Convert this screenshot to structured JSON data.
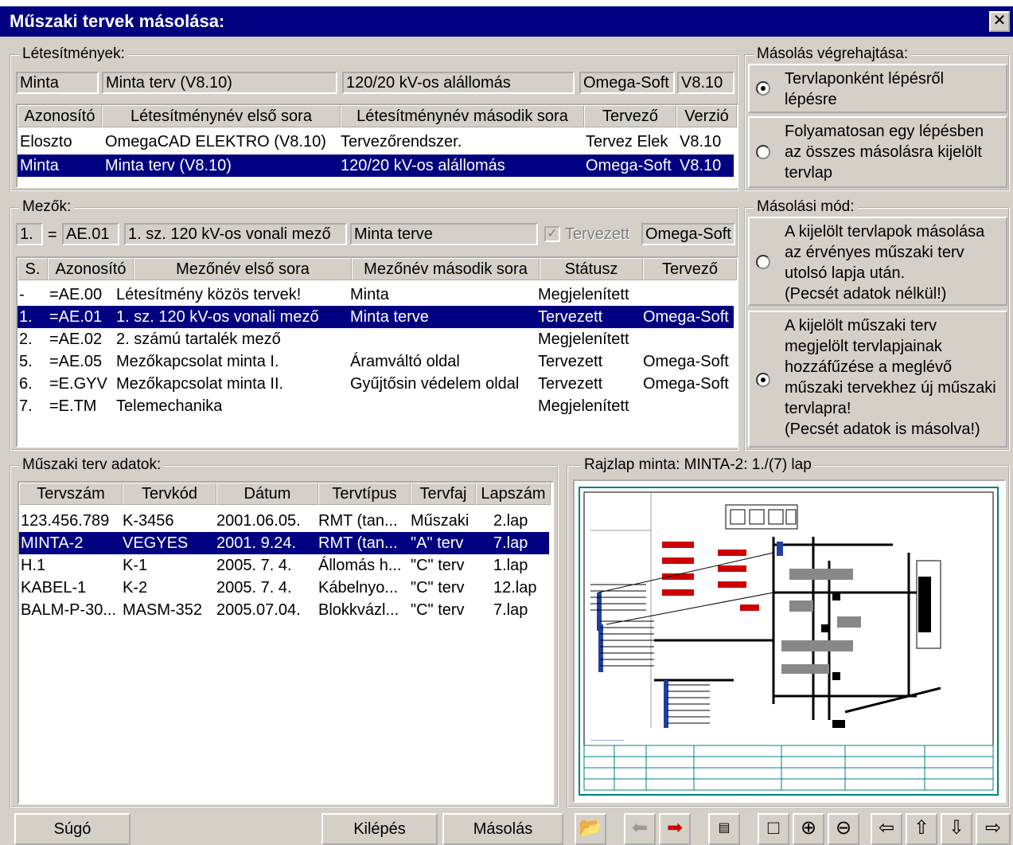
{
  "window": {
    "title": "Műszaki tervek másolása:",
    "close": "✕"
  },
  "letesitmenyek": {
    "legend": "Létesítmények:",
    "fields": [
      "Minta",
      "Minta terv (V8.10)",
      "120/20 kV-os alállomás",
      "Omega-Soft",
      "V8.10"
    ],
    "headers": [
      "Azonosító",
      "Létesítménynév első sora",
      "Létesítménynév második sora",
      "Tervező",
      "Verzió"
    ],
    "rows": [
      [
        "Eloszto",
        "OmegaCAD ELEKTRO (V8.10)",
        "Tervezőrendszer.",
        "Tervez Elek",
        "V8.10"
      ],
      [
        "Minta",
        "Minta terv (V8.10)",
        "120/20 kV-os alállomás",
        "Omega-Soft",
        "V8.10"
      ]
    ]
  },
  "masolas": {
    "legend": "Másolás végrehajtása:",
    "opt1": [
      "Tervlaponként lépésről",
      "lépésre"
    ],
    "opt2": [
      "Folyamatosan egy lépésben",
      "az összes másolásra kijelölt",
      "tervlap"
    ]
  },
  "mezok": {
    "legend": "Mezők:",
    "f_s": "1.",
    "f_eq": "=",
    "f_id": "AE.01",
    "f_name": "1. sz. 120 kV-os vonali mező",
    "f_name2": "Minta terve",
    "f_check": "Tervezett",
    "f_tervezo": "Omega-Soft",
    "headers": [
      "S.",
      "Azonosító",
      "Mezőnév első sora",
      "Mezőnév második sora",
      "Státusz",
      "Tervező"
    ],
    "rows": [
      [
        "-",
        "=AE.00",
        "Létesítmény közös tervek!",
        "Minta",
        "Megjelenített",
        ""
      ],
      [
        "1.",
        "=AE.01",
        "1. sz. 120 kV-os vonali mező",
        "Minta terve",
        "Tervezett",
        "Omega-Soft"
      ],
      [
        "2.",
        "=AE.02",
        "2. számú tartalék mező",
        "",
        "Megjelenített",
        ""
      ],
      [
        "5.",
        "=AE.05",
        "Mezőkapcsolat minta I.",
        "Áramváltó oldal",
        "Tervezett",
        "Omega-Soft"
      ],
      [
        "6.",
        "=E.GYV",
        "Mezőkapcsolat minta II.",
        "Gyűjtősin védelem oldal",
        "Tervezett",
        "Omega-Soft"
      ],
      [
        "7.",
        "=E.TM",
        "Telemechanika",
        "",
        "Megjelenített",
        ""
      ]
    ]
  },
  "masolasi_mod": {
    "legend": "Másolási mód:",
    "opt1": [
      "A kijelölt tervlapok másolása",
      "az érvényes műszaki terv",
      "utolsó lapja után.",
      "(Pecsét adatok nélkül!)"
    ],
    "opt2": [
      "A kijelölt műszaki terv",
      "megjelölt tervlapjainak",
      "hozzáfűzése a meglévő",
      "műszaki tervekhez új műszaki",
      "tervlapra!",
      "(Pecsét adatok is másolva!)"
    ]
  },
  "terv": {
    "legend": "Műszaki terv adatok:",
    "headers": [
      "Tervszám",
      "Tervkód",
      "Dátum",
      "Tervtípus",
      "Tervfaj",
      "Lapszám"
    ],
    "rows": [
      [
        "123.456.789",
        "K-3456",
        "2001.06.05.",
        "RMT (tan...",
        "Műszaki",
        "2.lap"
      ],
      [
        "MINTA-2",
        "VEGYES",
        "2001. 9.24.",
        "RMT (tan...",
        "\"A\" terv",
        "7.lap"
      ],
      [
        "H.1",
        "K-1",
        "2005. 7. 4.",
        "Állomás h...",
        "\"C\" terv",
        "1.lap"
      ],
      [
        "KABEL-1",
        "K-2",
        "2005. 7. 4.",
        "Kábelnyo...",
        "\"C\" terv",
        "12.lap"
      ],
      [
        "BALM-P-30...",
        "MASM-352",
        "2005.07.04.",
        "Blokkvázl...",
        "\"C\" terv",
        "7.lap"
      ]
    ]
  },
  "rajz": {
    "legend": "Rajzlap minta:  MINTA-2: 1./(7) lap"
  },
  "buttons": {
    "help": "Súgó",
    "exit": "Kilépés",
    "copy": "Másolás"
  },
  "icons": [
    "folder-open-icon",
    "arrow-left-gray-icon",
    "arrow-right-red-icon",
    "sheet-icon",
    "frame-icon",
    "zoom-in-icon",
    "zoom-out-icon",
    "arrow-left-icon",
    "arrow-up-icon",
    "arrow-down-icon",
    "arrow-right-icon"
  ]
}
